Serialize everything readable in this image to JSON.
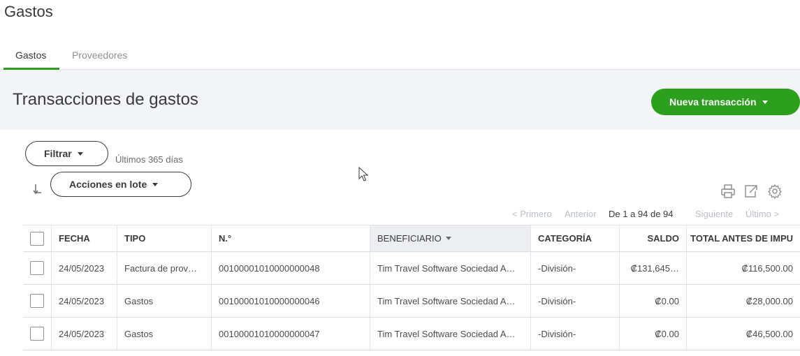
{
  "app": {
    "title": "Gastos"
  },
  "tabs": [
    {
      "label": "Gastos",
      "active": true
    },
    {
      "label": "Proveedores",
      "active": false
    }
  ],
  "section": {
    "title": "Transacciones de gastos",
    "new_button_label": "Nueva transacción"
  },
  "filters": {
    "filter_label": "Filtrar",
    "filter_value": "Últimos 365 días",
    "batch_label": "Acciones en lote"
  },
  "pagination": {
    "first": "< Primero",
    "previous": "Anterior",
    "range": "De 1 a 94 de 94",
    "next": "Siguiente",
    "last": "Último >"
  },
  "table": {
    "columns": [
      "FECHA",
      "TIPO",
      "N.°",
      "BENEFICIARIO",
      "CATEGORÍA",
      "SALDO",
      "TOTAL ANTES DE IMPU"
    ],
    "rows": [
      {
        "fecha": "24/05/2023",
        "tipo": "Factura de prov…",
        "numero": "00100001010000000048",
        "beneficiario": "Tim Travel Software Sociedad A…",
        "categoria": "-División-",
        "saldo": "₡131,645…",
        "total": "₡116,500.00"
      },
      {
        "fecha": "24/05/2023",
        "tipo": "Gastos",
        "numero": "00100001010000000046",
        "beneficiario": "Tim Travel Software Sociedad A…",
        "categoria": "-División-",
        "saldo": "₡0.00",
        "total": "₡28,000.00"
      },
      {
        "fecha": "24/05/2023",
        "tipo": "Gastos",
        "numero": "00100001010000000047",
        "beneficiario": "Tim Travel Software Sociedad A…",
        "categoria": "-División-",
        "saldo": "₡0.00",
        "total": "₡46,500.00"
      }
    ]
  },
  "colors": {
    "accent": "#2ca01c",
    "text": "#393a3d",
    "band": "#f4f5f8"
  }
}
